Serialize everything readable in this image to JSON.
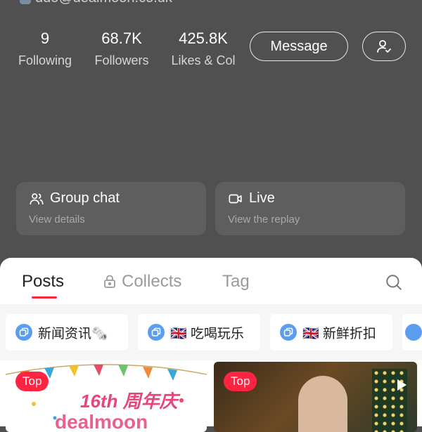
{
  "profile": {
    "email": "ddo@dealmoon.co.uk"
  },
  "stats": [
    {
      "value": "9",
      "label": "Following"
    },
    {
      "value": "68.7K",
      "label": "Followers"
    },
    {
      "value": "425.8K",
      "label": "Likes & Col"
    }
  ],
  "actions": {
    "message_label": "Message",
    "follow_icon": "user-check-icon"
  },
  "cards": {
    "group_chat": {
      "title": "Group chat",
      "subtitle": "View details"
    },
    "live": {
      "title": "Live",
      "subtitle": "View the replay"
    }
  },
  "tabs": {
    "posts": "Posts",
    "collects": "Collects",
    "tag": "Tag"
  },
  "chips": [
    {
      "label": "新闻资讯🗞️"
    },
    {
      "label": "🇬🇧 吃喝玩乐"
    },
    {
      "label": "🇬🇧 新鲜折扣"
    }
  ],
  "posts": [
    {
      "badge": "Top",
      "overlay_text": "16th 周年庆",
      "brand_text": "dealmoon"
    },
    {
      "badge": "Top"
    }
  ],
  "colors": {
    "accent": "#ff2442",
    "header_bg": "#505050",
    "chip_icon": "#5b9ef0"
  }
}
